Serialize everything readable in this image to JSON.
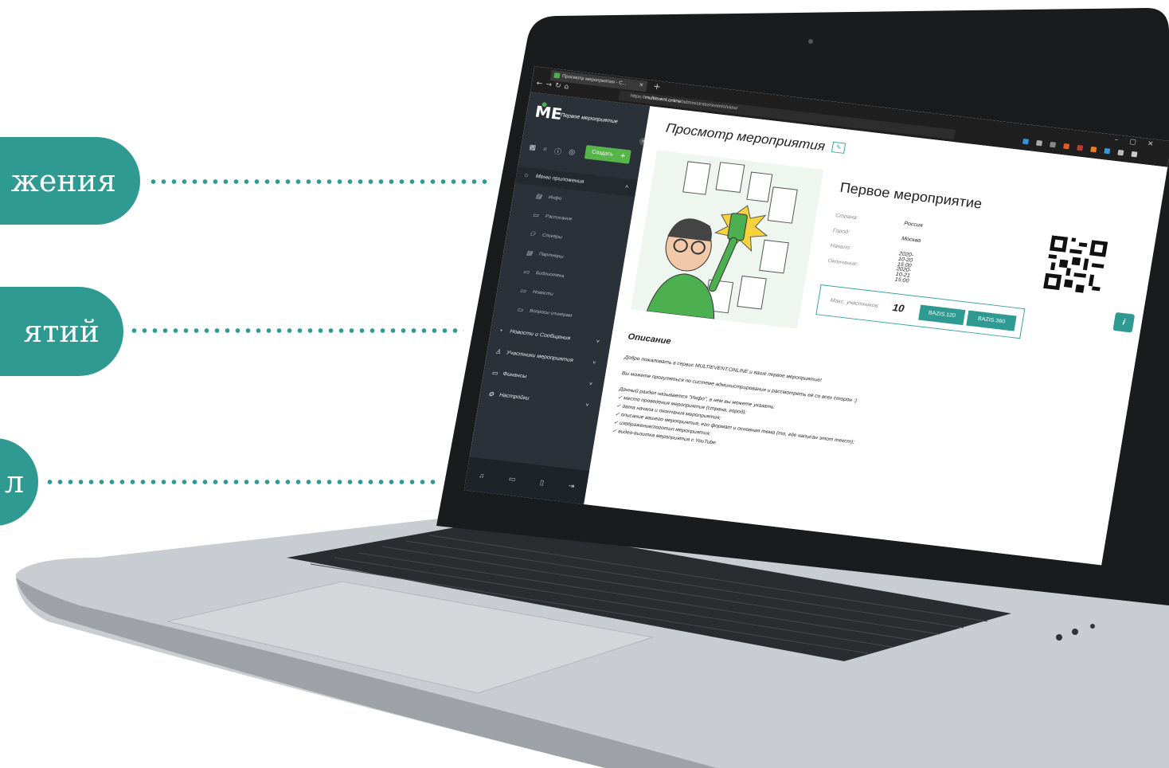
{
  "callouts": [
    {
      "label": "жения"
    },
    {
      "label": "ятий"
    },
    {
      "label": "л"
    }
  ],
  "browser": {
    "tab_title": "Просмотр мероприятия - С...",
    "url_prefix": "https://",
    "url_host": "multievent.online",
    "url_path": "/administrator/events/view/"
  },
  "sidebar": {
    "event_title": "Первое мероприятие",
    "create_label": "Создать",
    "menu_head": "Меню приложения",
    "sub_items": [
      {
        "label": "Инфо",
        "icon": "document-icon"
      },
      {
        "label": "Расписание",
        "icon": "calendar-icon"
      },
      {
        "label": "Спикеры",
        "icon": "speakers-icon"
      },
      {
        "label": "Партнеры",
        "icon": "partners-icon"
      },
      {
        "label": "Библиотека",
        "icon": "library-icon"
      },
      {
        "label": "Новости",
        "icon": "news-icon"
      },
      {
        "label": "Вопросы спикерам",
        "icon": "questions-icon"
      }
    ],
    "sections": [
      {
        "label": "Новости и Сообщения",
        "icon": "bell-icon"
      },
      {
        "label": "Участники мероприятия",
        "icon": "users-icon"
      },
      {
        "label": "Финансы",
        "icon": "wallet-icon"
      },
      {
        "label": "Настройки",
        "icon": "gear-icon"
      }
    ]
  },
  "main": {
    "page_title": "Просмотр мероприятия",
    "event_name": "Первое мероприятие",
    "info": [
      {
        "key": "Страна:",
        "value": "Россия"
      },
      {
        "key": "Город:",
        "value": "Москва"
      },
      {
        "key": "Начало:",
        "value": "2020-10-20 15:00"
      },
      {
        "key": "Окончание:",
        "value": "2020-10-21 15:00"
      }
    ],
    "max_label": "Макс. участников:",
    "max_value": "10",
    "plan_buttons": [
      "BAZIS.120",
      "BAZIS.360"
    ],
    "description_heading": "Описание",
    "description_lines": [
      "Добро пожаловать в сервис MULTIEVENT.ONLINE и ваше первое мероприятие!",
      "Вы можете прогуляться по системе администрирования и рассмотреть её со всех сторон :)",
      "Данный раздел называется \"Инфо\", в нем вы можете указать:",
      "✓ место проведения мероприятия (страна, город);",
      "✓ дата начала и окончания мероприятия;",
      "✓ описание вашего мероприятия, его формат и основная тема (то, где написан этот текст);",
      "✓ изображение/логотип мероприятия;",
      "✓ видео-визитка мероприятия с YouTube."
    ]
  },
  "colors": {
    "accent": "#2e9a92",
    "sidebar": "#2a3138",
    "create": "#56b44a"
  }
}
